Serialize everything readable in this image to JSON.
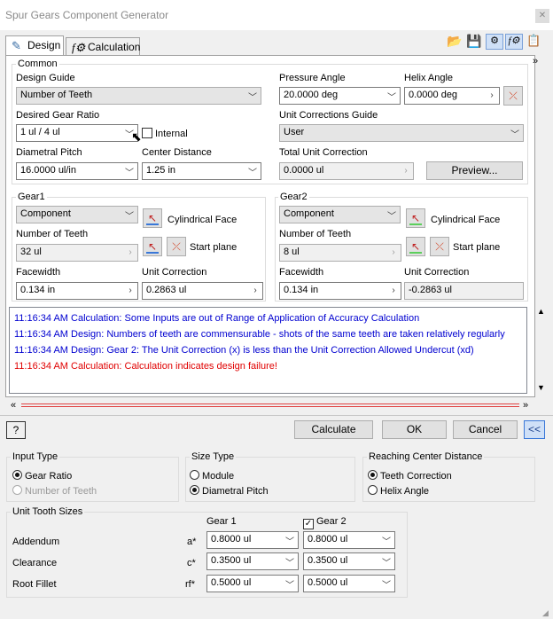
{
  "window": {
    "title": "Spur Gears Component Generator",
    "close": "✕"
  },
  "tabs": [
    {
      "label": "Design"
    },
    {
      "label": "Calculation"
    }
  ],
  "common": {
    "legend": "Common",
    "design_guide_label": "Design Guide",
    "design_guide_value": "Number of Teeth",
    "ratio_label": "Desired Gear Ratio",
    "ratio_value": "1 ul / 4 ul",
    "internal_label": "Internal",
    "pitch_label": "Diametral Pitch",
    "pitch_value": "16.0000 ul/in",
    "center_label": "Center Distance",
    "center_value": "1.25 in",
    "pressure_label": "Pressure Angle",
    "pressure_value": "20.0000 deg",
    "helix_label": "Helix Angle",
    "helix_value": "0.0000 deg",
    "ucg_label": "Unit Corrections Guide",
    "ucg_value": "User",
    "tuc_label": "Total Unit Correction",
    "tuc_value": "0.0000 ul",
    "preview_label": "Preview..."
  },
  "gear1": {
    "legend": "Gear1",
    "type_value": "Component",
    "cyl_label": "Cylindrical Face",
    "start_label": "Start plane",
    "teeth_label": "Number of Teeth",
    "teeth_value": "32 ul",
    "face_label": "Facewidth",
    "face_value": "0.134 in",
    "uc_label": "Unit Correction",
    "uc_value": "0.2863 ul"
  },
  "gear2": {
    "legend": "Gear2",
    "type_value": "Component",
    "cyl_label": "Cylindrical Face",
    "start_label": "Start plane",
    "teeth_label": "Number of Teeth",
    "teeth_value": "8 ul",
    "face_label": "Facewidth",
    "face_value": "0.134 in",
    "uc_label": "Unit Correction",
    "uc_value": "-0.2863 ul"
  },
  "log": [
    {
      "text": "11:16:34 AM Calculation: Some Inputs are out of Range of Application of Accuracy Calculation"
    },
    {
      "text": "11:16:34 AM Design: Numbers of teeth are commensurable - shots of the same teeth are taken relatively regularly"
    },
    {
      "text": "11:16:34 AM Design: Gear 2: The Unit Correction (x) is less than the Unit Correction Allowed Undercut (xd)"
    },
    {
      "text": "11:16:34 AM Calculation: Calculation indicates design failure!"
    }
  ],
  "buttons": {
    "calculate": "Calculate",
    "ok": "OK",
    "cancel": "Cancel",
    "collapse": "<<",
    "help": "?"
  },
  "input_type": {
    "legend": "Input Type",
    "opt1": "Gear Ratio",
    "opt2": "Number of Teeth"
  },
  "size_type": {
    "legend": "Size Type",
    "opt1": "Module",
    "opt2": "Diametral Pitch"
  },
  "reaching": {
    "legend": "Reaching Center Distance",
    "opt1": "Teeth Correction",
    "opt2": "Helix Angle"
  },
  "tooth": {
    "legend": "Unit Tooth Sizes",
    "gear1_header": "Gear 1",
    "gear2_header": "Gear 2",
    "rows": [
      {
        "label": "Addendum",
        "sym": "a*",
        "g1": "0.8000 ul",
        "g2": "0.8000 ul"
      },
      {
        "label": "Clearance",
        "sym": "c*",
        "g1": "0.3500 ul",
        "g2": "0.3500 ul"
      },
      {
        "label": "Root Fillet",
        "sym": "rf*",
        "g1": "0.5000 ul",
        "g2": "0.5000 ul"
      }
    ]
  },
  "colors": {
    "log_info": "#0000d0",
    "log_error": "#e00000",
    "gear1_line": "#3a78d8",
    "gear2_line": "#5ccf5c"
  }
}
